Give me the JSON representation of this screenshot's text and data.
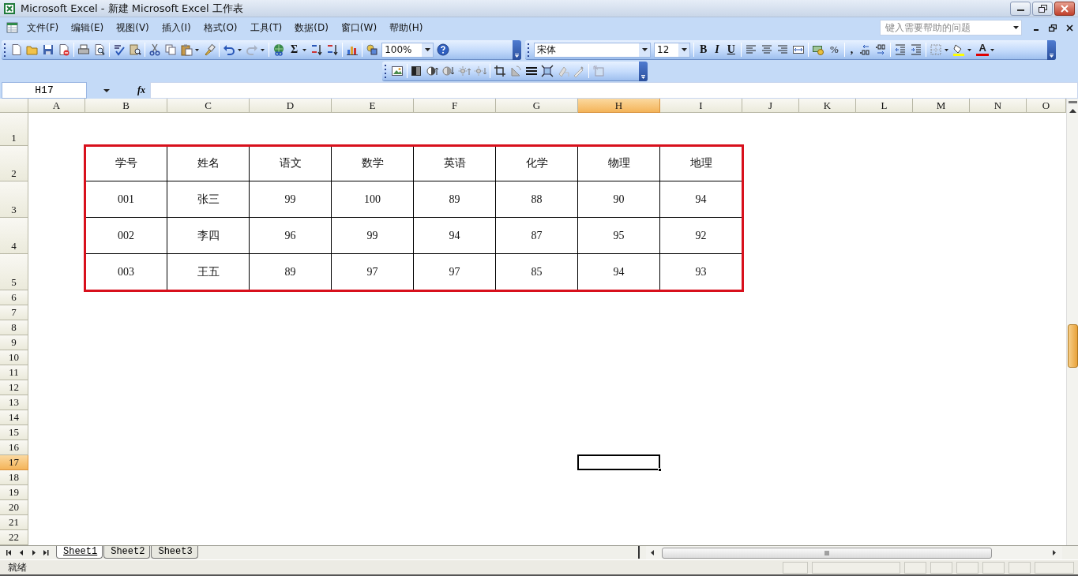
{
  "window": {
    "title": "Microsoft Excel - 新建 Microsoft Excel 工作表"
  },
  "menu": [
    "文件(F)",
    "编辑(E)",
    "视图(V)",
    "插入(I)",
    "格式(O)",
    "工具(T)",
    "数据(D)",
    "窗口(W)",
    "帮助(H)"
  ],
  "help_box": {
    "placeholder": "键入需要帮助的问题"
  },
  "standard_toolbar": {
    "autosum": "Σ",
    "zoom": "100%"
  },
  "formatting_toolbar": {
    "font": "宋体",
    "size": "12",
    "bold": "B",
    "italic": "I",
    "underline": "U",
    "percent": "%",
    "comma": ",",
    "font_color": "A"
  },
  "formula_bar": {
    "name_box": "H17",
    "label": "fx"
  },
  "sheet": {
    "columns": [
      {
        "label": "A",
        "selected": false
      },
      {
        "label": "B",
        "selected": false
      },
      {
        "label": "C",
        "selected": false
      },
      {
        "label": "D",
        "selected": false
      },
      {
        "label": "E",
        "selected": false
      },
      {
        "label": "F",
        "selected": false
      },
      {
        "label": "G",
        "selected": false
      },
      {
        "label": "H",
        "selected": true
      },
      {
        "label": "I",
        "selected": false
      },
      {
        "label": "J",
        "selected": false
      },
      {
        "label": "K",
        "selected": false
      },
      {
        "label": "L",
        "selected": false
      },
      {
        "label": "M",
        "selected": false
      },
      {
        "label": "N",
        "selected": false
      },
      {
        "label": "O",
        "selected": false
      }
    ],
    "rows": [
      {
        "label": "1",
        "selected": false
      },
      {
        "label": "2",
        "selected": false
      },
      {
        "label": "3",
        "selected": false
      },
      {
        "label": "4",
        "selected": false
      },
      {
        "label": "5",
        "selected": false
      },
      {
        "label": "6",
        "selected": false
      },
      {
        "label": "7",
        "selected": false
      },
      {
        "label": "8",
        "selected": false
      },
      {
        "label": "9",
        "selected": false
      },
      {
        "label": "10",
        "selected": false
      },
      {
        "label": "11",
        "selected": false
      },
      {
        "label": "12",
        "selected": false
      },
      {
        "label": "13",
        "selected": false
      },
      {
        "label": "14",
        "selected": false
      },
      {
        "label": "15",
        "selected": false
      },
      {
        "label": "16",
        "selected": false
      },
      {
        "label": "17",
        "selected": true
      },
      {
        "label": "18",
        "selected": false
      },
      {
        "label": "19",
        "selected": false
      },
      {
        "label": "20",
        "selected": false
      },
      {
        "label": "21",
        "selected": false
      },
      {
        "label": "22",
        "selected": false
      }
    ],
    "table": {
      "columns": [
        "学号",
        "姓名",
        "语文",
        "数学",
        "英语",
        "化学",
        "物理",
        "地理"
      ],
      "rows": [
        [
          "001",
          "张三",
          "99",
          "100",
          "89",
          "88",
          "90",
          "94"
        ],
        [
          "002",
          "李四",
          "96",
          "99",
          "94",
          "87",
          "95",
          "92"
        ],
        [
          "003",
          "王五",
          "89",
          "97",
          "97",
          "85",
          "94",
          "93"
        ]
      ]
    }
  },
  "sheet_tabs": [
    {
      "label": "Sheet1",
      "selected": true
    },
    {
      "label": "Sheet2",
      "selected": false
    },
    {
      "label": "Sheet3",
      "selected": false
    }
  ],
  "status_bar": {
    "text": "就绪"
  }
}
